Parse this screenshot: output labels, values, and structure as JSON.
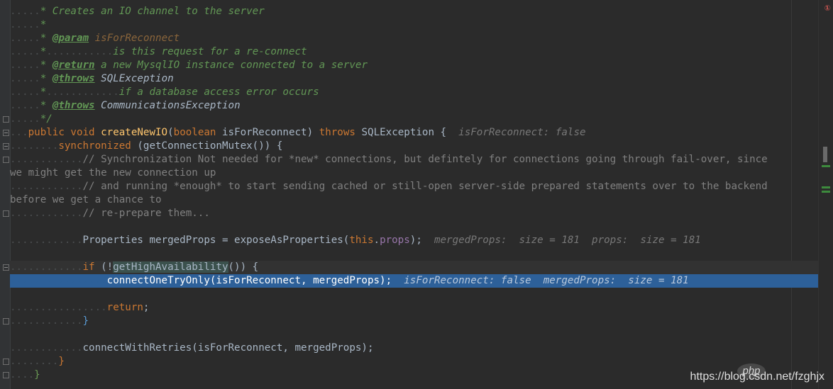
{
  "doc": {
    "l1": {
      "ws": ".....",
      "t1": "* Creates an IO channel to the server"
    },
    "l2": {
      "ws": ".....",
      "t1": "*"
    },
    "l3": {
      "ws": ".....",
      "t1": "* ",
      "tag": "@param",
      "t2": " ",
      "val": "isForReconnect"
    },
    "l4": {
      "ws": ".....",
      "t1": "*",
      "ws2": "...........",
      "t2": "is this request for a re-connect"
    },
    "l5": {
      "ws": ".....",
      "t1": "* ",
      "tag": "@return",
      "t2": " a new MysqlIO instance connected to a server"
    },
    "l6": {
      "ws": ".....",
      "t1": "* ",
      "tag": "@throws",
      "t2": " ",
      "ref": "SQLException"
    },
    "l7": {
      "ws": ".....",
      "t1": "*",
      "ws2": "............",
      "t2": "if a database access error occurs"
    },
    "l8": {
      "ws": ".....",
      "t1": "* ",
      "tag": "@throws",
      "t2": " ",
      "ref": "CommunicationsException"
    },
    "l9": {
      "ws": ".....",
      "t1": "*/"
    }
  },
  "code": {
    "sig": {
      "ws": "...",
      "kw1": "public",
      "kw2": "void",
      "fn": "createNewIO",
      "p1": "(",
      "kw3": "boolean",
      "param": "isForReconnect",
      "p2": ")",
      "kw4": "throws",
      "exc": "SQLException",
      "brace": "{",
      "hint": "isForReconnect: false"
    },
    "sync": {
      "ws": "........",
      "kw": "synchronized",
      "rest": " (getConnectionMutex()) {"
    },
    "c1": {
      "ws": "............",
      "text": "// Synchronization Not needed for *new* connections, but defintely for connections going through fail-over, since"
    },
    "c1b": {
      "text": "we might get the new connection up"
    },
    "c2": {
      "ws": "............",
      "text": "// and running *enough* to start sending cached or still-open server-side prepared statements over to the backend"
    },
    "c2b": {
      "text": "before we get a chance to"
    },
    "c3": {
      "ws": "............",
      "text": "// re-prepare them..."
    },
    "props": {
      "ws": "............",
      "t1": "Properties mergedProps = exposeAsProperties(",
      "kw": "this",
      "dot": ".",
      "fld": "props",
      "t2": ");",
      "hint": "mergedProps:  size = 181  props:  size = 181"
    },
    "ifl": {
      "ws": "............",
      "kw": "if",
      "t1": " (!",
      "call": "getHighAvailability",
      "t2": "()) {"
    },
    "exec": {
      "ws": "................",
      "t1": "connectOneTryOnly(isForReconnect, mergedProps);",
      "hint": "isForReconnect: false  mergedProps:  size = 181"
    },
    "ret": {
      "ws": "................",
      "kw": "return",
      "t1": ";"
    },
    "close_if": {
      "ws": "............",
      "t1": "}"
    },
    "retries": {
      "ws": "............",
      "t1": "connectWithRetries(isForReconnect, mergedProps);"
    },
    "close_sync": {
      "ws": "........",
      "t1": "}"
    },
    "close_method": {
      "ws": "....",
      "t1": "}"
    }
  },
  "scrollbar": {
    "error_icon": "①"
  },
  "watermark": {
    "logo": "php",
    "text": "https://blog.csdn.net/fzghjx"
  },
  "colors": {
    "background": "#2b2b2b",
    "execution_line": "#2d6099",
    "keyword": "#cc7832",
    "comment": "#629755"
  }
}
